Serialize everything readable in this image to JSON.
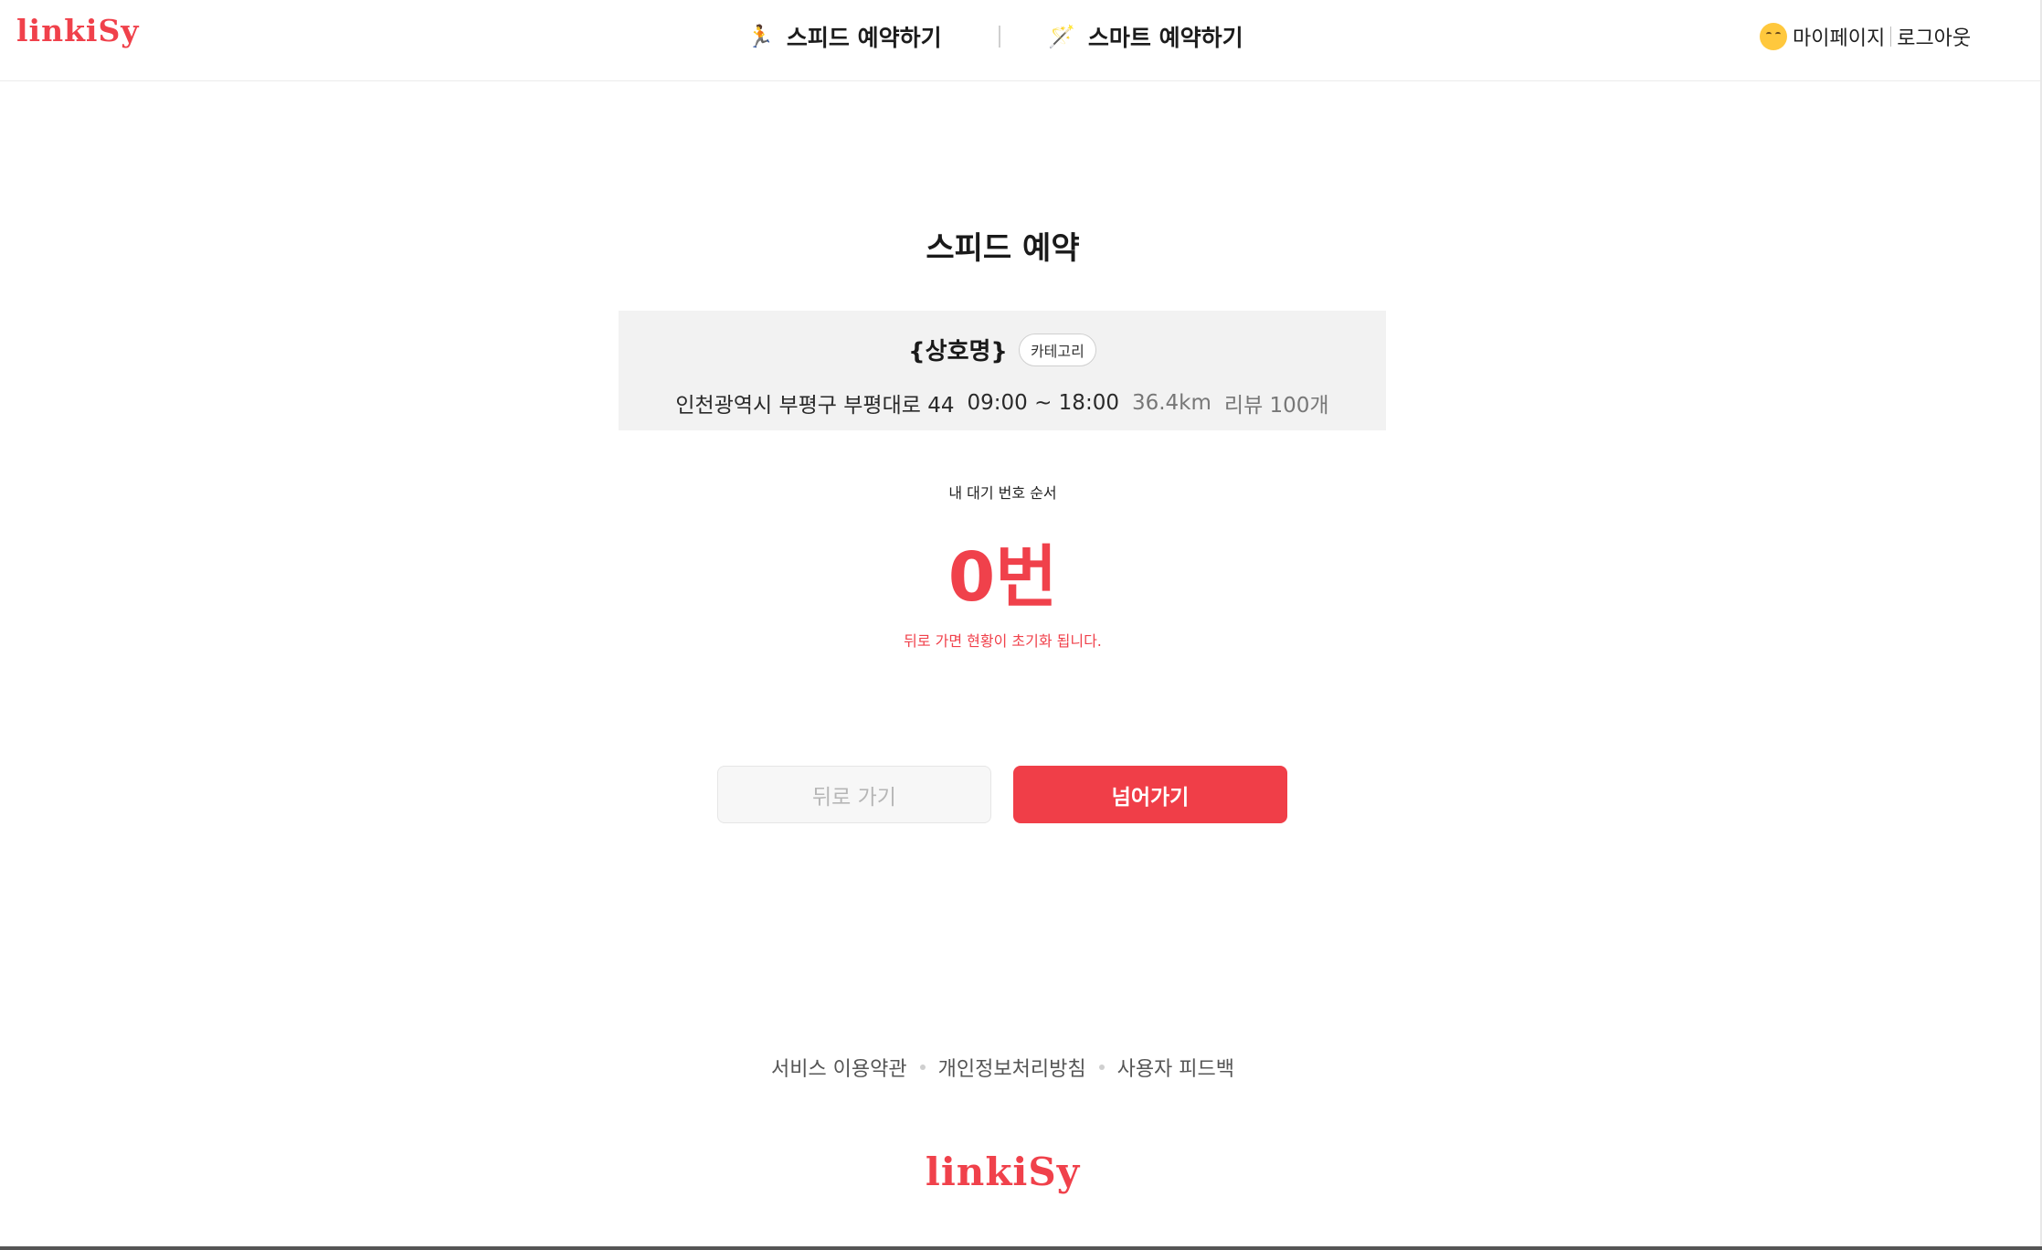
{
  "header": {
    "logo": "linkiSy",
    "nav": [
      {
        "icon": "running-person-icon",
        "glyph": "🏃",
        "label": "스피드 예약하기"
      },
      {
        "icon": "magic-wand-icon",
        "glyph": "🪄",
        "label": "스마트 예약하기"
      }
    ],
    "user": {
      "mypage_label": "마이페이지",
      "logout_label": "로그아웃"
    }
  },
  "main": {
    "title": "스피드 예약",
    "store": {
      "name": "{상호명}",
      "category": "카테고리",
      "address": "인천광역시 부평구 부평대로 44",
      "hours": "09:00 ~ 18:00",
      "distance": "36.4km",
      "reviews": "리뷰 100개"
    },
    "wait": {
      "label": "내 대기 번호 순서",
      "number": "0번",
      "warning": "뒤로 가면 현황이 초기화 됩니다."
    },
    "buttons": {
      "back": "뒤로 가기",
      "next": "넘어가기"
    }
  },
  "footer": {
    "links": [
      "서비스 이용약관",
      "개인정보처리방침",
      "사용자 피드백"
    ],
    "logo": "linkiSy"
  },
  "colors": {
    "brand": "#f0414b",
    "card_background": "#f2f2f2"
  }
}
